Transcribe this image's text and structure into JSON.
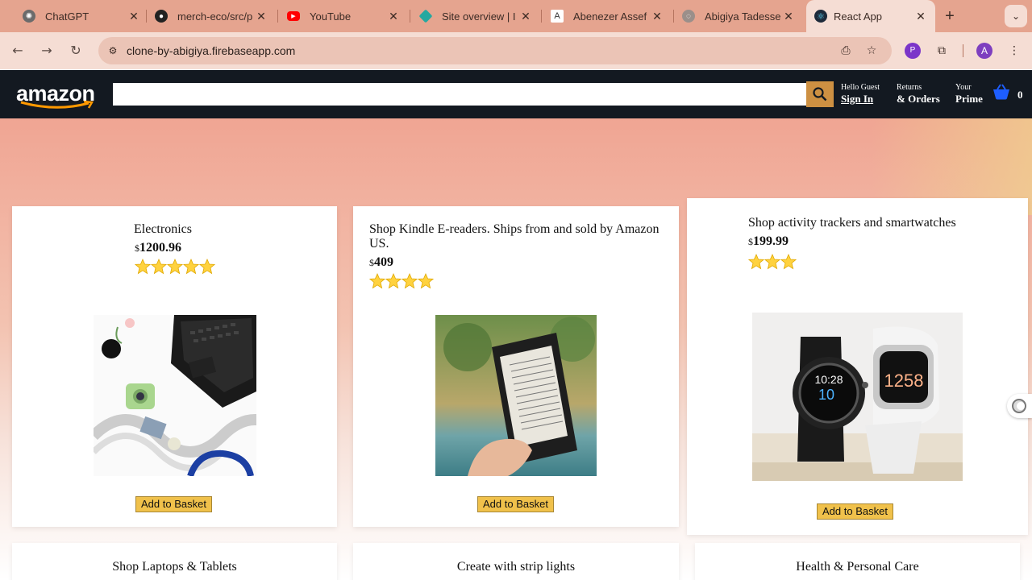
{
  "browser": {
    "tabs": [
      {
        "title": "ChatGPT",
        "icon": "chatgpt-icon",
        "color": "#6b6b6b"
      },
      {
        "title": "merch-eco/src/p",
        "icon": "github-icon",
        "color": "#222222"
      },
      {
        "title": "YouTube",
        "icon": "youtube-icon",
        "color": "#ff0000"
      },
      {
        "title": "Site overview | I",
        "icon": "netlify-icon",
        "color": "#25a8a0"
      },
      {
        "title": "Abenezer Assef",
        "icon": "doc-icon",
        "color": "#ffffff"
      },
      {
        "title": "Abigiya Tadesse",
        "icon": "globe-icon",
        "color": "#9b8f8a"
      },
      {
        "title": "React App",
        "icon": "react-icon",
        "color": "#1d2a3a"
      }
    ],
    "url": "clone-by-abigiya.firebaseapp.com",
    "extension_label": "P",
    "profile_initial": "A"
  },
  "header": {
    "logo_text": "amazon",
    "search_placeholder": "",
    "account": {
      "line1": "Hello Guest",
      "line2": "Sign In"
    },
    "orders": {
      "line1": "Returns",
      "line2": "& Orders"
    },
    "prime": {
      "line1": "Your",
      "line2": "Prime"
    },
    "basket_count": "0"
  },
  "products": [
    {
      "title": "Electronics",
      "currency": "$",
      "price": "1200.96",
      "rating": 5,
      "button": "Add to Basket"
    },
    {
      "title": "Shop Kindle E-readers. Ships from and sold by Amazon US.",
      "currency": "$",
      "price": "409",
      "rating": 4,
      "button": "Add to Basket"
    },
    {
      "title": "Shop activity trackers and smartwatches",
      "currency": "$",
      "price": "199.99",
      "rating": 3,
      "button": "Add to Basket"
    }
  ],
  "more_products": [
    {
      "title": "Shop Laptops & Tablets"
    },
    {
      "title": "Create with strip lights"
    },
    {
      "title": "Health & Personal Care"
    }
  ],
  "colors": {
    "header_bg": "#131921",
    "search_button": "#cd9042",
    "add_button": "#f0c14b",
    "tabstrip": "#e5a48f"
  }
}
